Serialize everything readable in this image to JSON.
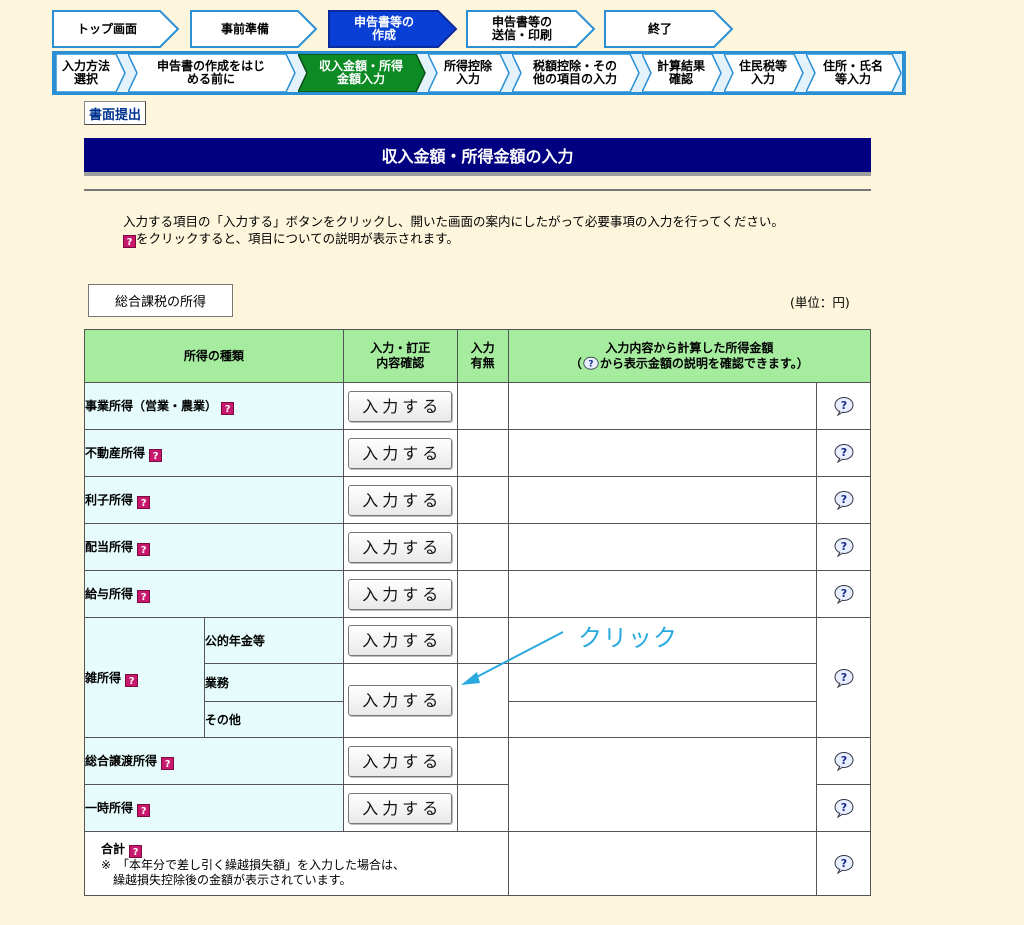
{
  "nav_main": [
    {
      "label": "トップ画面",
      "active": false
    },
    {
      "label": "事前準備",
      "active": false
    },
    {
      "label": "申告書等の\n作成",
      "active": true
    },
    {
      "label": "申告書等の\n送信・印刷",
      "active": false
    },
    {
      "label": "終了",
      "active": false
    }
  ],
  "nav_sub": [
    {
      "label": "入力方法\n選択",
      "active": false
    },
    {
      "label": "申告書の作成をはじ\nめる前に",
      "active": false
    },
    {
      "label": "収入金額・所得\n金額入力",
      "active": true
    },
    {
      "label": "所得控除\n入力",
      "active": false
    },
    {
      "label": "税額控除・その\n他の項目の入力",
      "active": false
    },
    {
      "label": "計算結果\n確認",
      "active": false
    },
    {
      "label": "住民税等\n入力",
      "active": false
    },
    {
      "label": "住所・氏名\n等入力",
      "active": false
    }
  ],
  "submit_button": "書面提出",
  "page_title": "収入金額・所得金額の入力",
  "instructions": {
    "line1": "入力する項目の「入力する」ボタンをクリックし、開いた画面の案内にしたがって必要事項の入力を行ってください。",
    "line2_suffix": "をクリックすると、項目についての説明が表示されます。",
    "qmark": "?"
  },
  "section_tab": "総合課税の所得",
  "unit_label": "(単位：円)",
  "table": {
    "header_type": "所得の種類",
    "header_confirm": "入力・訂正\n内容確認",
    "header_status": "入力\n有無",
    "header_amount_line1": "入力内容から計算した所得金額",
    "header_amount_line2_prefix": "（",
    "header_amount_line2_suffix": "から表示金額の説明を確認できます。）",
    "input_button": "入力する",
    "rows": {
      "business": "事業所得（営業・農業）",
      "real_estate": "不動産所得",
      "interest": "利子所得",
      "dividend": "配当所得",
      "salary": "給与所得",
      "misc": "雑所得",
      "misc_pension": "公的年金等",
      "misc_business": "業務",
      "misc_other": "その他",
      "transfer": "総合譲渡所得",
      "temporary": "一時所得",
      "total": "合計",
      "total_note1": "※　「本年分で差し引く繰越損失額」を入力した場合は、",
      "total_note2": "　繰越損失控除後の金額が表示されています。"
    }
  },
  "annotation": "クリック",
  "colors": {
    "nav_active": "#0a3fd6",
    "nav_sub_active": "#0c8a24",
    "title_bar": "#000080",
    "header_bg": "#a5ec9f",
    "label_bg": "#e6fbfb",
    "page_bg": "#fdf5dc",
    "annotation": "#2aa9e0"
  }
}
